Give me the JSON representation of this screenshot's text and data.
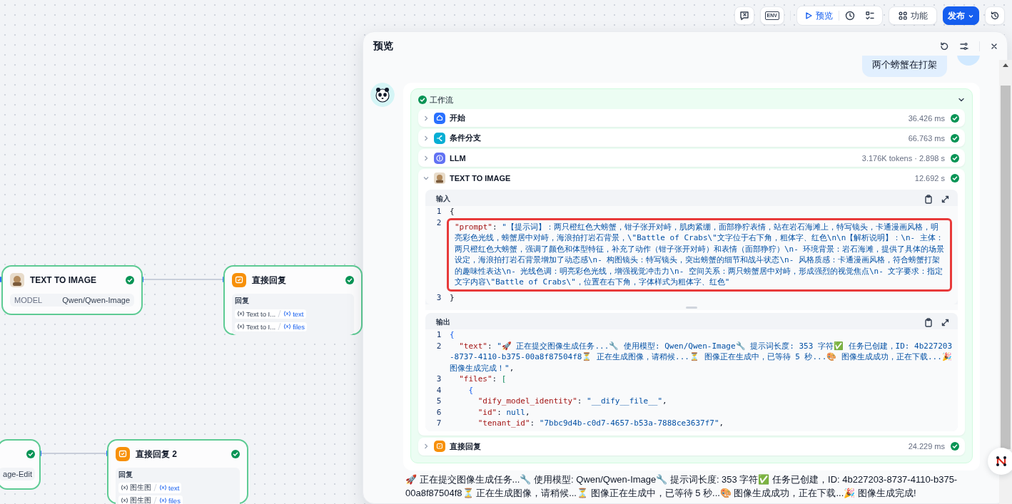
{
  "toolbar": {
    "env": "ENV",
    "preview": "预览",
    "features": "功能",
    "publish": "发布"
  },
  "canvas": {
    "nodes": [
      {
        "kind": "model",
        "title": "TEXT TO IMAGE",
        "success": true,
        "field_label": "MODEL",
        "field_value": "Qwen/Qwen-Image"
      },
      {
        "kind": "reply",
        "title": "直接回复",
        "success": true,
        "section_label": "回复",
        "vars": [
          {
            "source": "Text to I...",
            "name": "text"
          },
          {
            "source": "Text to I...",
            "name": "files"
          }
        ]
      },
      {
        "kind": "model_cut",
        "success": true,
        "field_value": "age-Edit"
      },
      {
        "kind": "reply",
        "title": "直接回复 2",
        "success": true,
        "section_label": "回复",
        "vars": [
          {
            "source": "图生图",
            "name": "text"
          },
          {
            "source": "图生图",
            "name": "files"
          }
        ]
      }
    ]
  },
  "preview": {
    "title": "预览",
    "user_message": "两个螃蟹在打架",
    "workflow": {
      "label": "工作流",
      "expanded": true,
      "steps": [
        {
          "kind": "start",
          "name": "开始",
          "meta": "36.426 ms",
          "expanded": false,
          "success": true
        },
        {
          "kind": "branch",
          "name": "条件分支",
          "meta": "66.763 ms",
          "expanded": false,
          "success": true
        },
        {
          "kind": "llm",
          "name": "LLM",
          "meta": "3.176K tokens · 2.898 s",
          "expanded": false,
          "success": true
        },
        {
          "kind": "image",
          "name": "TEXT TO IMAGE",
          "meta": "12.692 s",
          "expanded": true,
          "success": true,
          "panels": [
            {
              "label": "输入",
              "lines": [
                {
                  "number": "1",
                  "tokens": [
                    {
                      "kind": "punct",
                      "text": "{"
                    }
                  ]
                },
                {
                  "number": "2",
                  "highlighted": true,
                  "tokens": [
                    {
                      "kind": "key",
                      "text": "\"prompt\""
                    },
                    {
                      "kind": "punct",
                      "text": ": "
                    },
                    {
                      "kind": "string",
                      "text": "\"【提示词】：两只橙红色大螃蟹，钳子张开对峙，肌肉紧绷，面部狰狞表情，站在岩石海滩上，特写镜头，卡通漫画风格，明亮彩色光线，螃蟹居中对峙，海浪拍打岩石背景，\\\"Battle of Crabs\\\"文字位于右下角，粗体字、红色\\n\\n【解析说明】：\\n- 主体：两只橙红色大螃蟹，强调了颜色和体型特征，补充了动作（钳子张开对峙）和表情（面部狰狞）\\n- 环境背景：岩石海滩，提供了具体的场景设定，海浪拍打岩石背景增加了动态感\\n- 构图镜头：特写镜头，突出螃蟹的细节和战斗状态\\n- 风格质感：卡通漫画风格，符合螃蟹打架的趣味性表达\\n- 光线色调：明亮彩色光线，增强视觉冲击力\\n- 空间关系：两只螃蟹居中对峙，形成强烈的视觉焦点\\n- 文字要求：指定文字内容\\\"Battle of Crabs\\\"，位置在右下角，字体样式为粗体字、红色\""
                    }
                  ]
                },
                {
                  "number": "3",
                  "tokens": [
                    {
                      "kind": "punct",
                      "text": "}"
                    }
                  ]
                }
              ]
            },
            {
              "label": "输出",
              "lines": [
                {
                  "number": "1",
                  "tokens": [
                    {
                      "kind": "bracket",
                      "text": "{"
                    }
                  ]
                },
                {
                  "number": "2",
                  "tokens": [
                    {
                      "kind": "key",
                      "text": "  \"text\""
                    },
                    {
                      "kind": "punct",
                      "text": ": "
                    },
                    {
                      "kind": "string",
                      "text": "\"🚀 正在提交图像生成任务...🔧 使用模型: Qwen/Qwen-Image🔧 提示词长度: 353 字符✅ 任务已创建，ID: 4b227203-8737-4110-b375-00a8f87504f8⏳ 正在生成图像，请稍候...⏳ 图像正在生成中，已等待 5 秒...🎨 图像生成成功，正在下载...🎉 图像生成完成！\""
                    },
                    {
                      "kind": "punct",
                      "text": ","
                    }
                  ]
                },
                {
                  "number": "3",
                  "tokens": [
                    {
                      "kind": "key",
                      "text": "  \"files\""
                    },
                    {
                      "kind": "punct",
                      "text": ": "
                    },
                    {
                      "kind": "bracket2",
                      "text": "["
                    }
                  ]
                },
                {
                  "number": "4",
                  "tokens": [
                    {
                      "kind": "bracket",
                      "text": "    {"
                    }
                  ]
                },
                {
                  "number": "5",
                  "tokens": [
                    {
                      "kind": "key",
                      "text": "      \"dify_model_identity\""
                    },
                    {
                      "kind": "punct",
                      "text": ": "
                    },
                    {
                      "kind": "string",
                      "text": "\"__dify__file__\""
                    },
                    {
                      "kind": "punct",
                      "text": ","
                    }
                  ]
                },
                {
                  "number": "6",
                  "tokens": [
                    {
                      "kind": "key",
                      "text": "      \"id\""
                    },
                    {
                      "kind": "punct",
                      "text": ": "
                    },
                    {
                      "kind": "keyword",
                      "text": "null"
                    },
                    {
                      "kind": "punct",
                      "text": ","
                    }
                  ]
                },
                {
                  "number": "7",
                  "tokens": [
                    {
                      "kind": "key",
                      "text": "      \"tenant_id\""
                    },
                    {
                      "kind": "punct",
                      "text": ": "
                    },
                    {
                      "kind": "string",
                      "text": "\"7bbc9d4b-c0d7-4657-b53a-7888ce3637f7\""
                    },
                    {
                      "kind": "punct",
                      "text": ","
                    }
                  ]
                }
              ]
            }
          ]
        },
        {
          "kind": "reply",
          "name": "直接回复",
          "meta": "24.229 ms",
          "expanded": false,
          "success": true
        }
      ]
    },
    "answer": "🚀 正在提交图像生成任务...🔧 使用模型: Qwen/Qwen-Image🔧 提示词长度: 353 字符✅ 任务已创建，ID: 4b227203-8737-4110-b375-00a8f87504f8⏳ 正在生成图像，请稍候...⏳ 图像正在生成中，已等待 5 秒...🎨 图像生成成功，正在下载...🎉 图像生成完成!"
  }
}
